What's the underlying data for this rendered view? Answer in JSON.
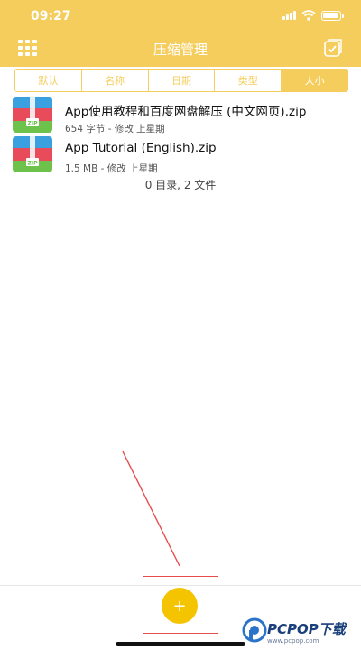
{
  "status_bar": {
    "time": "09:27"
  },
  "header": {
    "title": "压缩管理"
  },
  "sort_tabs": [
    {
      "label": "默认",
      "active": false
    },
    {
      "label": "名称",
      "active": false
    },
    {
      "label": "日期",
      "active": false
    },
    {
      "label": "类型",
      "active": false
    },
    {
      "label": "大小",
      "active": true
    }
  ],
  "files": [
    {
      "name": "App使用教程和百度网盘解压 (中文网页).zip",
      "meta": "654 字节 - 修改 上星期",
      "icon": "zip-file-icon",
      "icon_label": "ZIP"
    },
    {
      "name": "App Tutorial (English).zip",
      "meta": "1.5 MB - 修改 上星期",
      "icon": "zip-file-icon",
      "icon_label": "ZIP"
    }
  ],
  "summary": "0 目录, 2 文件",
  "bottom_bar": {
    "add_label": "+"
  },
  "colors": {
    "accent": "#f5cd5c",
    "add_button": "#f5c400",
    "highlight": "#e74c4c"
  },
  "watermark": {
    "text": "PCPOP下载",
    "sub": "www.pcpop.com"
  }
}
